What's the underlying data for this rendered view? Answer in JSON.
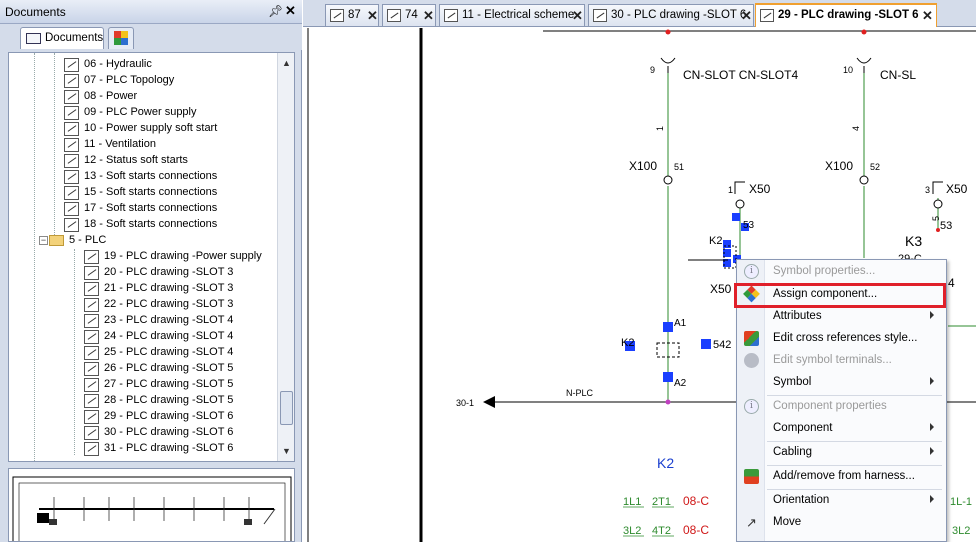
{
  "left_panel": {
    "title": "Documents",
    "pin_glyph": "↕",
    "close_glyph": "X",
    "tabs": [
      {
        "label": "Documents"
      },
      {
        "label": ""
      }
    ],
    "tree": {
      "items": [
        {
          "label": "06 - Hydraulic"
        },
        {
          "label": "07 - PLC Topology"
        },
        {
          "label": "08 - Power"
        },
        {
          "label": "09 - PLC Power supply"
        },
        {
          "label": "10 - Power supply soft start"
        },
        {
          "label": "11 - Ventilation"
        },
        {
          "label": "12 - Status soft starts"
        },
        {
          "label": "13 - Soft starts connections"
        },
        {
          "label": "15 - Soft starts connections"
        },
        {
          "label": "17 - Soft starts connections"
        },
        {
          "label": "18 - Soft starts connections"
        }
      ],
      "folder": {
        "label": "5 - PLC"
      },
      "children": [
        {
          "label": "19 - PLC drawing -Power supply"
        },
        {
          "label": "20 - PLC drawing -SLOT 3"
        },
        {
          "label": "21 - PLC drawing -SLOT 3"
        },
        {
          "label": "22 - PLC drawing -SLOT 3"
        },
        {
          "label": "23 - PLC drawing -SLOT 4"
        },
        {
          "label": "24 - PLC drawing -SLOT 4"
        },
        {
          "label": "25 - PLC drawing -SLOT 4"
        },
        {
          "label": "26 - PLC drawing -SLOT 5"
        },
        {
          "label": "27 - PLC drawing -SLOT 5"
        },
        {
          "label": "28 - PLC drawing -SLOT 5"
        },
        {
          "label": "29 - PLC drawing -SLOT 6"
        },
        {
          "label": "30 - PLC drawing -SLOT 6"
        },
        {
          "label": "31 - PLC drawing -SLOT 6"
        }
      ],
      "selected": "29 - PLC drawing -SLOT 6"
    }
  },
  "doc_tabs": [
    {
      "label": "87"
    },
    {
      "label": "74"
    },
    {
      "label": "11 - Electrical scheme"
    },
    {
      "label": "30 - PLC drawing -SLOT 6"
    },
    {
      "label": "29 - PLC drawing -SLOT 6",
      "active": true
    }
  ],
  "schematic": {
    "connectors": [
      {
        "num": "9",
        "label": "CN-SLOT CN-SLOT4",
        "wire": "1",
        "terminal": "X100",
        "pin": "51"
      },
      {
        "num": "10",
        "label": "CN-SL",
        "wire": "4",
        "terminal": "X100",
        "pin": "52"
      }
    ],
    "x50_labels": [
      {
        "num": "1",
        "label": "X50"
      },
      {
        "num": "3",
        "label": "X50"
      }
    ],
    "labels": {
      "k2": "K2",
      "k3": "K3",
      "k3_sub": "29-C",
      "x50_lower": "X50",
      "k2_left": "K2",
      "pin_a1": "A1",
      "pin_a2": "A2",
      "pin_542": "542",
      "pin_53": "53",
      "pin_53b": "53",
      "wire_5": "5",
      "bus_ref": "30-1",
      "bus_name": "N-PLC",
      "k2_bottom": "K2",
      "contact1_a": "1L1",
      "contact1_b": "2T1",
      "contact1_ref": "08-C",
      "contact2_a": "3L2",
      "contact2_b": "4T2",
      "contact2_ref": "08-C",
      "right_edge1": "1L-1",
      "right_edge2": "3L2",
      "k3_edge": "4"
    },
    "colors": {
      "wire": "#2e8b2e",
      "selection": "#1a3fff",
      "bus": "#000000",
      "ref": "#d01818",
      "blue_text": "#1a3fcf"
    }
  },
  "context_menu": {
    "items": [
      {
        "label": "Symbol properties...",
        "disabled": true,
        "icon": "info-icon"
      },
      {
        "label": "Assign component...",
        "icon": "component-cube-icon",
        "highlighted": true
      },
      {
        "label": "Attributes",
        "submenu": true
      },
      {
        "label": "Edit cross references style...",
        "icon": "cross-reference-icon"
      },
      {
        "label": "Edit symbol terminals...",
        "disabled": true,
        "icon": "terminals-icon"
      },
      {
        "label": "Symbol",
        "submenu": true
      },
      {
        "label": "Component properties",
        "disabled": true,
        "icon": "info-icon"
      },
      {
        "label": "Component",
        "submenu": true
      },
      {
        "label": "Cabling",
        "submenu": true
      },
      {
        "label": "Add/remove from harness...",
        "icon": "harness-icon"
      },
      {
        "label": "Orientation",
        "submenu": true
      },
      {
        "label": "Move",
        "icon": "move-icon"
      }
    ]
  }
}
